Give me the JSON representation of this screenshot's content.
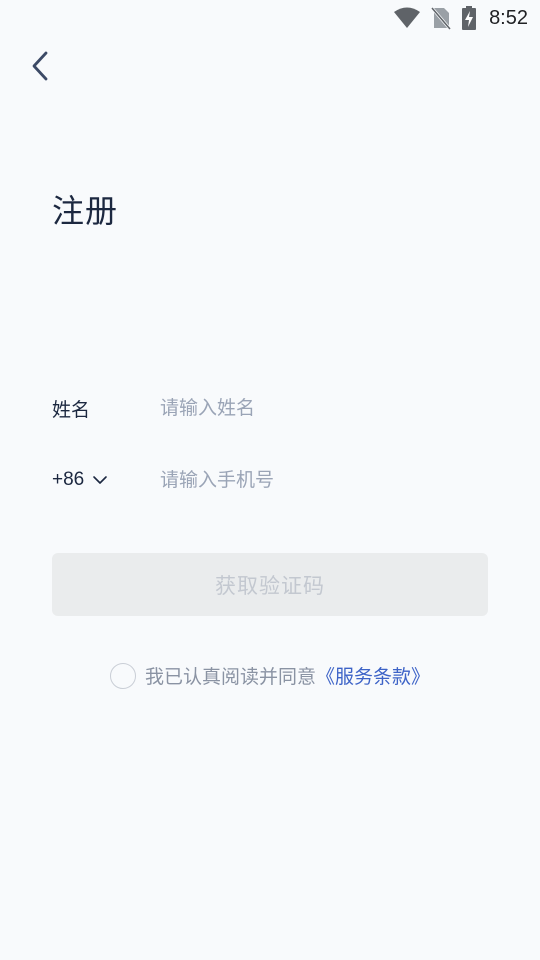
{
  "status_bar": {
    "time": "8:52",
    "icons": [
      "wifi-icon",
      "no-sim-icon",
      "battery-charging-icon"
    ]
  },
  "header": {
    "back_icon": "chevron-left-icon",
    "title": "注册"
  },
  "form": {
    "name_label": "姓名",
    "name_value": "",
    "name_placeholder": "请输入姓名",
    "country_code": "+86",
    "country_code_icon": "chevron-down-icon",
    "phone_value": "",
    "phone_placeholder": "请输入手机号"
  },
  "actions": {
    "get_code_label": "获取验证码"
  },
  "agreement": {
    "checked": false,
    "text": "我已认真阅读并同意",
    "terms_link": "《服务条款》"
  },
  "colors": {
    "background": "#f8fafc",
    "title_text": "#1c2840",
    "placeholder_text": "#9aa4b6",
    "disabled_button_bg": "#eaeced",
    "disabled_button_text": "#c3c8d0",
    "link": "#3d63c7"
  }
}
